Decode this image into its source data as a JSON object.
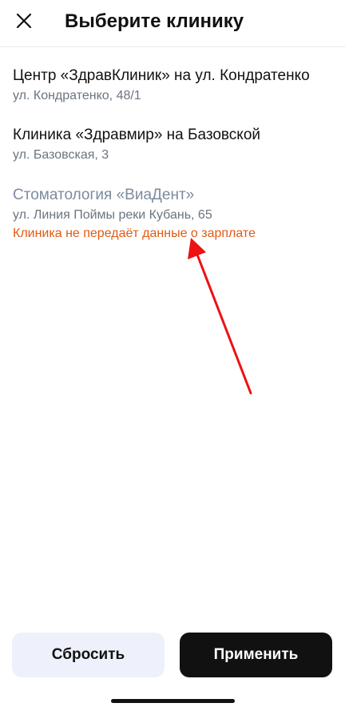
{
  "header": {
    "title": "Выберите клинику",
    "close_icon": "close-icon"
  },
  "clinics": [
    {
      "name": "Центр «ЗдравКлиник» на ул. Кондратенко",
      "address": "ул. Кондратенко, 48/1",
      "note": ""
    },
    {
      "name": "Клиника «Здравмир» на Базовской",
      "address": "ул. Базовская, 3",
      "note": ""
    },
    {
      "name": "Стоматология «ВиаДент»",
      "address": "ул. Линия Поймы реки Кубань, 65",
      "note": "Клиника не передаёт данные о зарплате",
      "disabled": true
    }
  ],
  "footer": {
    "reset_label": "Сбросить",
    "apply_label": "Применить"
  },
  "colors": {
    "warning": "#e05a12",
    "annotation_arrow": "#ee1111",
    "primary_button": "#111111",
    "secondary_button": "#eef1fb",
    "disabled_text": "#7d8a9e"
  }
}
